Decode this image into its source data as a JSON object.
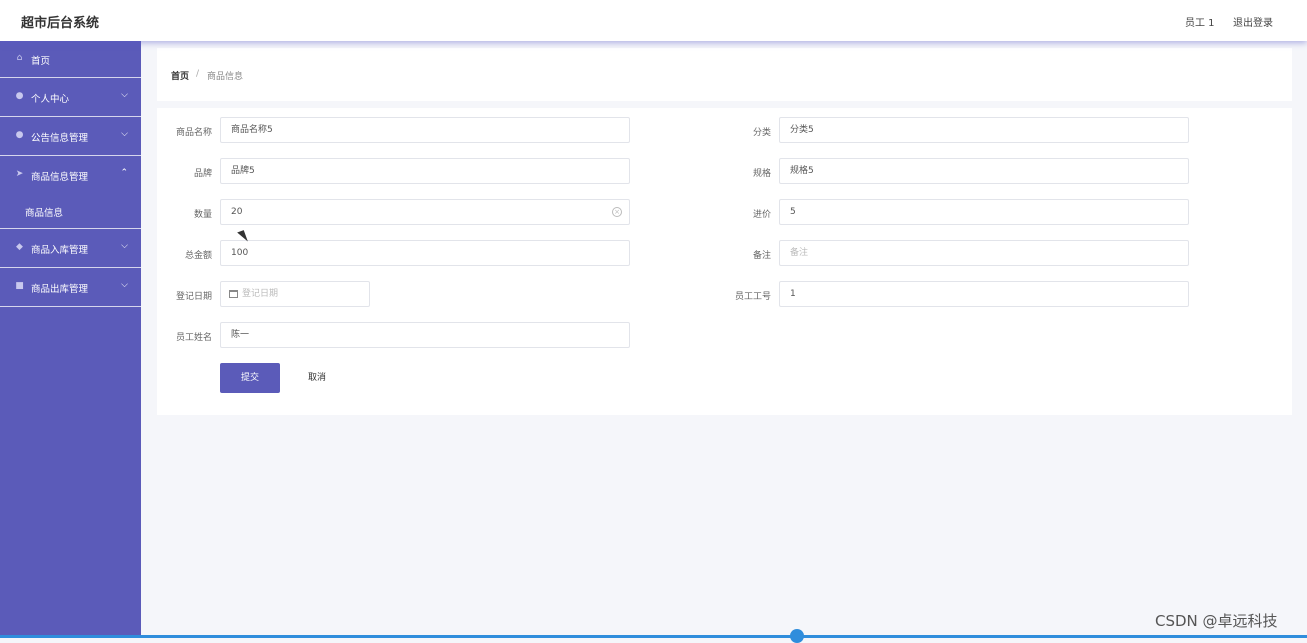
{
  "header": {
    "app_title": "超市后台系统",
    "user_name": "员工 1",
    "logout_label": "退出登录"
  },
  "sidebar": {
    "items": [
      {
        "label": "首页",
        "icon": "home-icon"
      },
      {
        "label": "个人中心",
        "icon": "user-icon"
      },
      {
        "label": "公告信息管理",
        "icon": "user-icon"
      },
      {
        "label": "商品信息管理",
        "icon": "send-icon",
        "expanded": true
      },
      {
        "label": "商品信息",
        "sub": true
      },
      {
        "label": "商品入库管理",
        "icon": "shield-icon"
      },
      {
        "label": "商品出库管理",
        "icon": "box-icon"
      }
    ]
  },
  "breadcrumb": {
    "home": "首页",
    "separator": "/",
    "current": "商品信息"
  },
  "form": {
    "fields": {
      "name": {
        "label": "商品名称",
        "value": "商品名称5"
      },
      "category": {
        "label": "分类",
        "value": "分类5"
      },
      "brand": {
        "label": "品牌",
        "value": "品牌5"
      },
      "spec": {
        "label": "规格",
        "value": "规格5"
      },
      "quantity": {
        "label": "数量",
        "value": "20"
      },
      "price": {
        "label": "进价",
        "value": "5"
      },
      "total": {
        "label": "总金额",
        "value": "100"
      },
      "remark": {
        "label": "备注",
        "placeholder": "备注"
      },
      "date": {
        "label": "登记日期",
        "placeholder": "登记日期"
      },
      "emp_no": {
        "label": "员工工号",
        "value": "1"
      },
      "emp_name": {
        "label": "员工姓名",
        "value": "陈一"
      }
    },
    "submit_label": "提交",
    "cancel_label": "取消"
  },
  "watermark": "CSDN @卓远科技",
  "colors": {
    "accent": "#5b5bb9",
    "progress": "#2f8ddc"
  }
}
